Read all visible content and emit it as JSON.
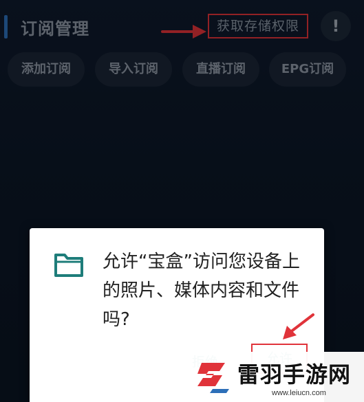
{
  "header": {
    "title": "订阅管理",
    "storage_button": "获取存储权限",
    "info_icon": "!"
  },
  "chips": [
    {
      "label": "添加订阅"
    },
    {
      "label": "导入订阅"
    },
    {
      "label": "直播订阅"
    },
    {
      "label": "EPG订阅"
    }
  ],
  "dialog": {
    "icon": "folder-icon",
    "message": "允许“宝盒”访问您设备上的照片、媒体内容和文件吗?",
    "deny_label": "拒绝",
    "allow_label": "允许"
  },
  "watermark": {
    "name": "雷羽手游网",
    "url": "www.leiucn.com"
  },
  "colors": {
    "background": "#0f1b2d",
    "highlight_box": "#e0333a",
    "dialog_accent": "#1e7d7a"
  }
}
